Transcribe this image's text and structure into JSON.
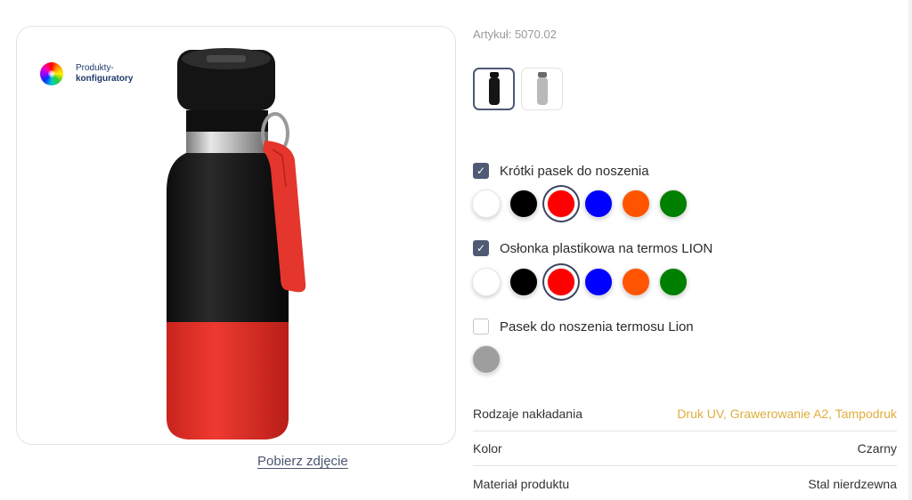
{
  "product_image": {
    "badge_line1": "Produkty-",
    "badge_line2": "konfiguratory",
    "download_label": "Pobierz zdjęcie"
  },
  "article": {
    "label": "Artykuł: 5070.02"
  },
  "thumbnails": [
    {
      "color": "black",
      "selected": true
    },
    {
      "color": "silver",
      "selected": false
    }
  ],
  "options": [
    {
      "label": "Krótki pasek do noszenia",
      "checked": true,
      "swatches": [
        "#ffffff",
        "#000000",
        "#ff0000",
        "#0000ff",
        "#ff5500",
        "#008000"
      ],
      "selected_index": 2
    },
    {
      "label": "Osłonka plastikowa na termos LION",
      "checked": true,
      "swatches": [
        "#ffffff",
        "#000000",
        "#ff0000",
        "#0000ff",
        "#ff5500",
        "#008000"
      ],
      "selected_index": 2
    },
    {
      "label": "Pasek do noszenia termosu Lion",
      "checked": false,
      "swatches": [
        "#9e9e9e"
      ],
      "selected_index": -1
    }
  ],
  "specs": [
    {
      "key": "Rodzaje nakładania",
      "value": "Druk UV, Grawerowanie A2, Tampodruk",
      "accent": true
    },
    {
      "key": "Kolor",
      "value": "Czarny",
      "accent": false
    },
    {
      "key": "Materiał produktu",
      "value": "Stal nierdzewna",
      "accent": false
    }
  ],
  "colors": {
    "accent": "#e0ad3c",
    "checkbox": "#4f5a74",
    "bottle_body": "#1a1a1a",
    "bottle_sleeve": "#e8332b"
  }
}
